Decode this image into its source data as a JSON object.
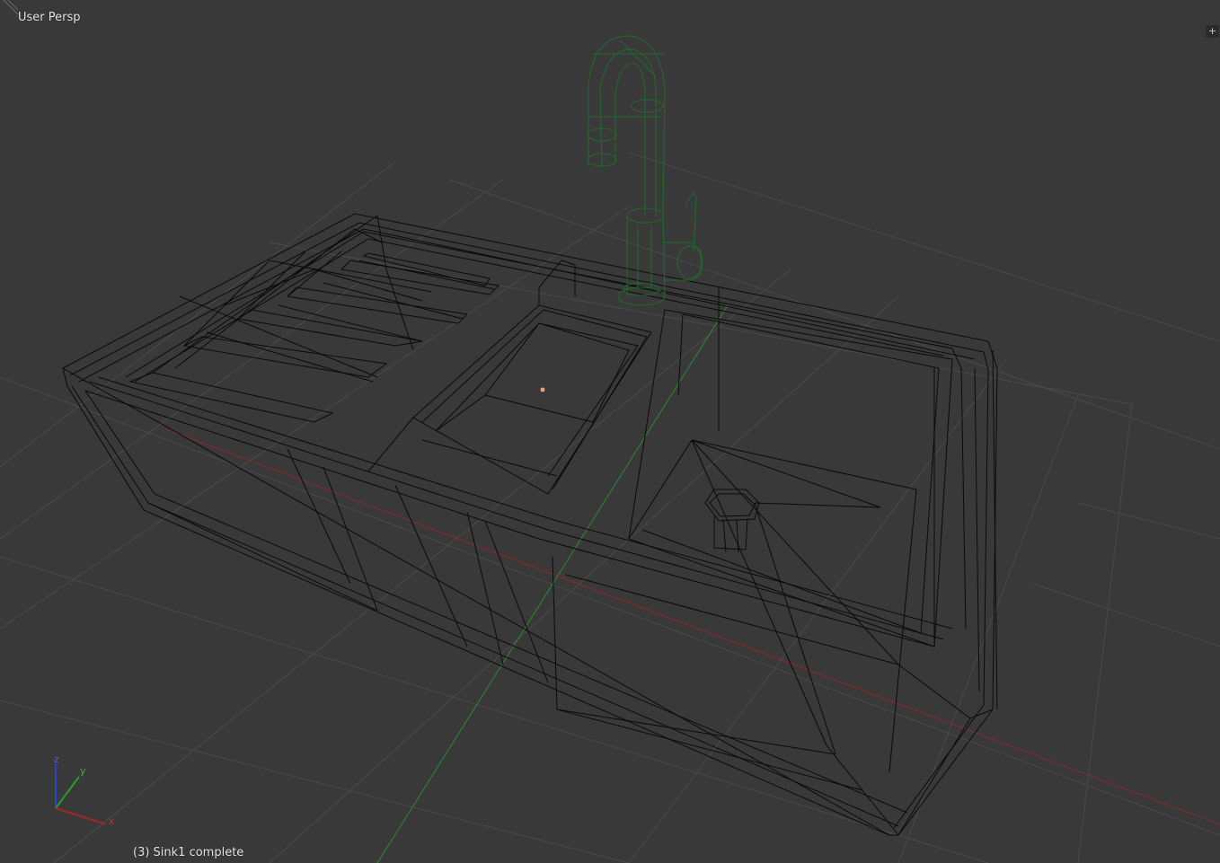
{
  "viewport": {
    "view_mode": "User Persp",
    "object_info": "(3) Sink1 complete",
    "toolbar_toggle_glyph": "+",
    "colors": {
      "background": "#393939",
      "grid": "#4a4a4a",
      "wire_black": "#0a0a0a",
      "wire_selected": "#1f6b2a",
      "axis_x": "#a02828",
      "axis_y": "#2e9a2e",
      "axis_z": "#2f3fd0",
      "origin": "#e0a080"
    }
  },
  "axis_gizmo": {
    "x_label": "x",
    "y_label": "y",
    "z_label": "z"
  },
  "scene": {
    "objects": [
      {
        "name": "sink",
        "icon": "wireframe-mesh",
        "selected": false
      },
      {
        "name": "faucet",
        "icon": "wireframe-mesh",
        "selected": true
      }
    ]
  }
}
